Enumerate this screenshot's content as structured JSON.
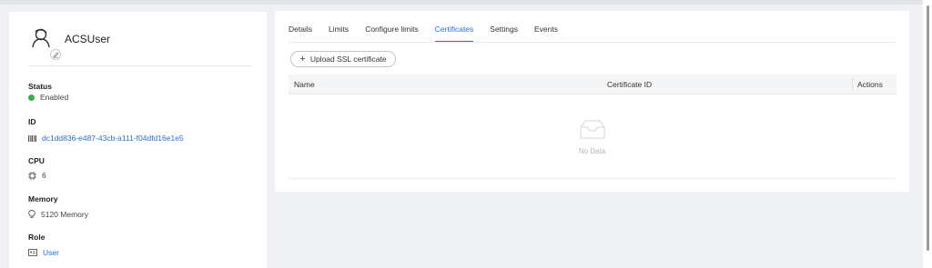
{
  "user": {
    "name": "ACSUser"
  },
  "details": {
    "status_label": "Status",
    "status_value": "Enabled",
    "status_color": "#36b24a",
    "id_label": "ID",
    "id_value": "dc1dd836-e487-43cb-a111-f04dfd16e1e5",
    "cpu_label": "CPU",
    "cpu_value": "6",
    "memory_label": "Memory",
    "memory_value": "5120 Memory",
    "role_label": "Role",
    "role_value": "User"
  },
  "tabs": [
    {
      "label": "Details",
      "active": false
    },
    {
      "label": "Limits",
      "active": false
    },
    {
      "label": "Configure limits",
      "active": false
    },
    {
      "label": "Certificates",
      "active": true
    },
    {
      "label": "Settings",
      "active": false
    },
    {
      "label": "Events",
      "active": false
    }
  ],
  "certificates": {
    "upload_label": "Upload SSL certificate",
    "columns": [
      "Name",
      "Certificate ID",
      "Actions"
    ],
    "rows": [],
    "empty_text": "No Data"
  },
  "colors": {
    "accent": "#2a6fd6",
    "background": "#f0f1f4"
  },
  "icons": {
    "avatar": "user-outline-icon",
    "edit": "edit-icon",
    "status": "green-dot",
    "id": "barcode-icon",
    "cpu": "chip-icon",
    "memory": "lightbulb-icon",
    "role": "id-card-icon",
    "upload": "plus-icon",
    "empty": "inbox-icon"
  }
}
